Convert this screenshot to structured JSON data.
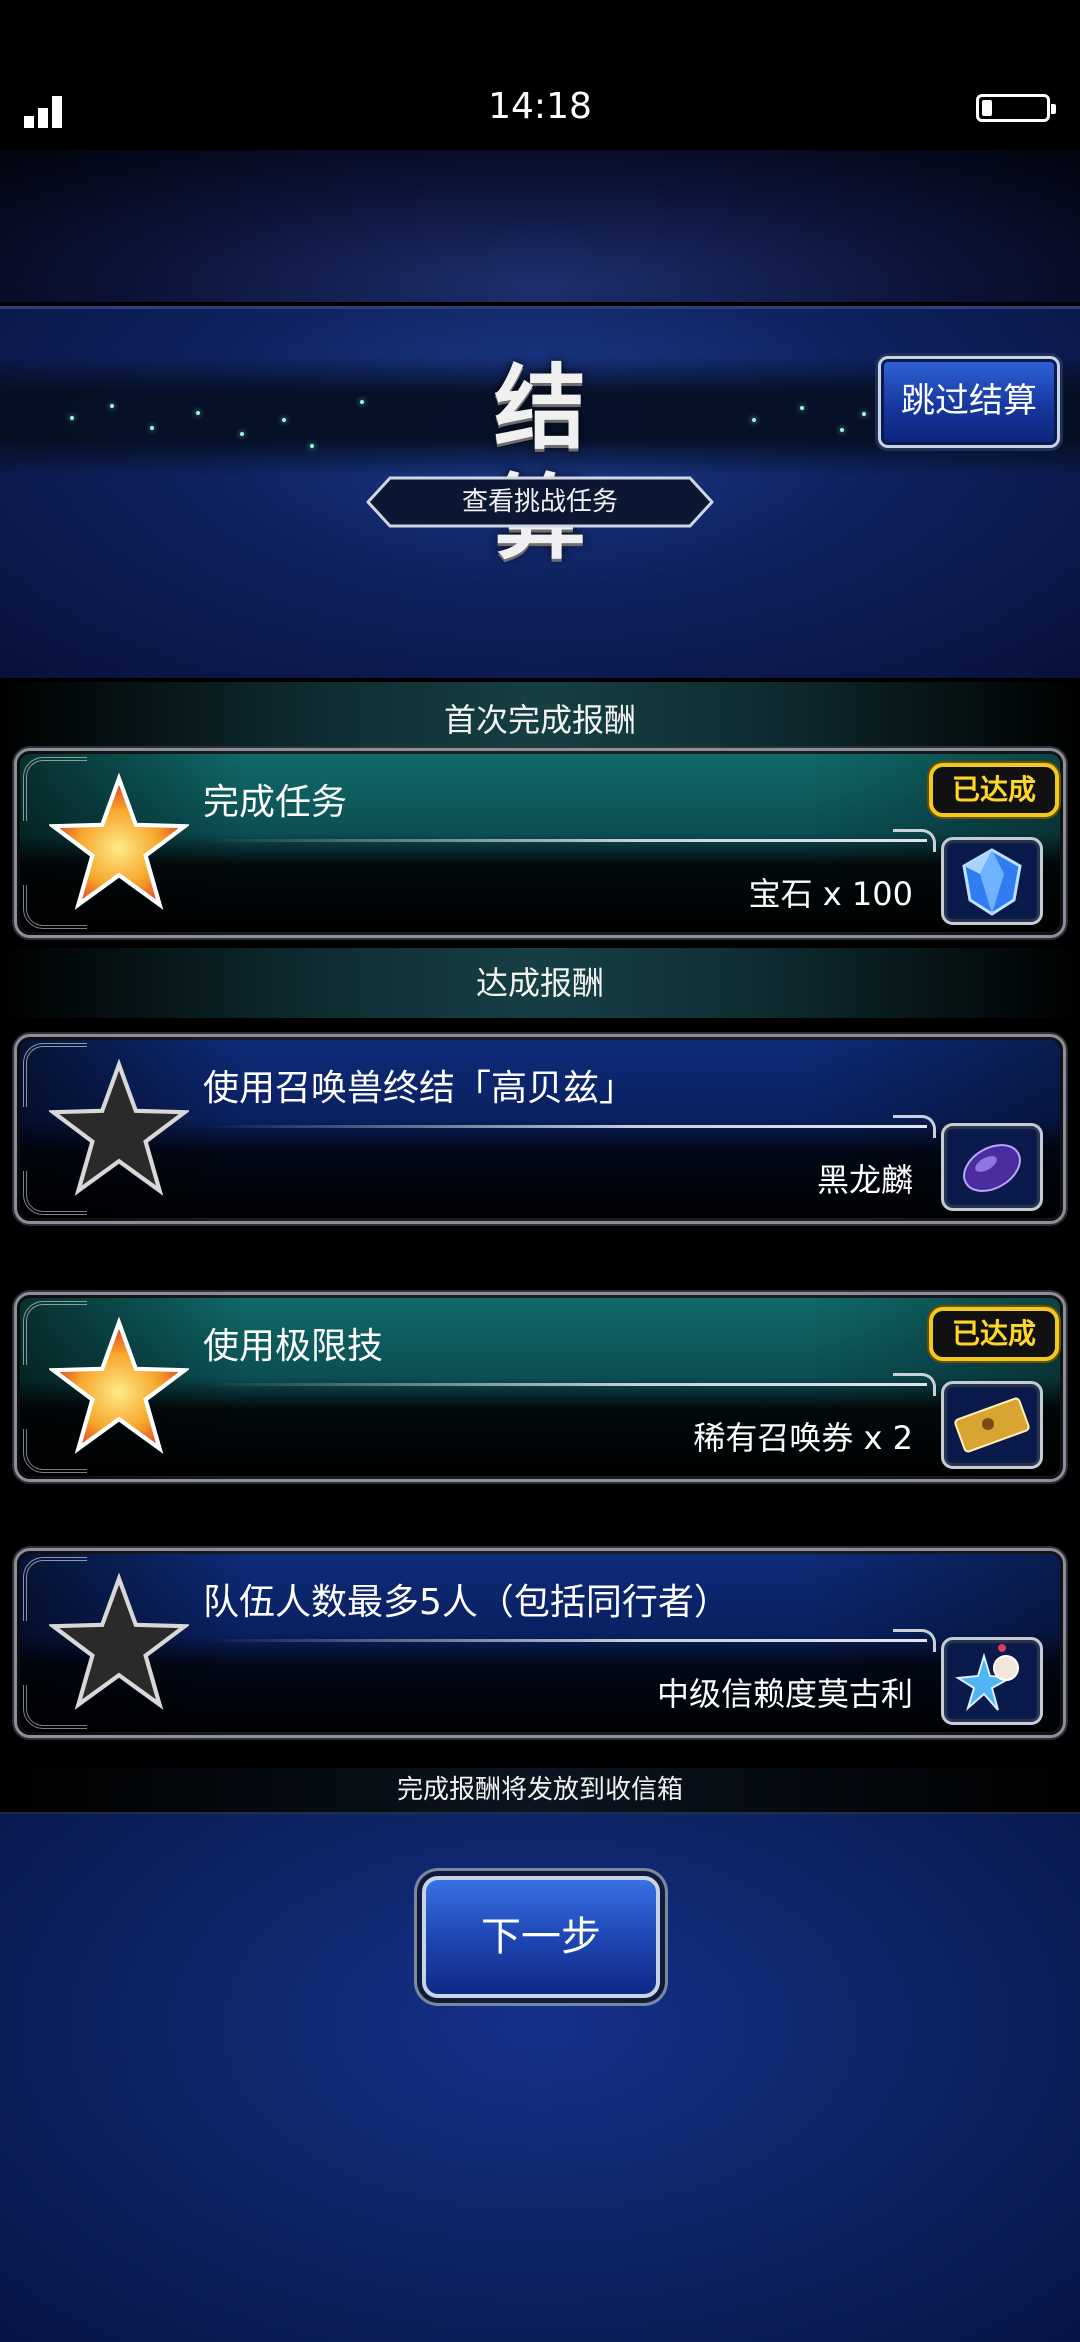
{
  "status_bar": {
    "time": "14:18"
  },
  "header": {
    "title": "结 算",
    "skip_button": "跳过结算",
    "view_missions_button": "查看挑战任务"
  },
  "sections": {
    "first_clear": "首次完成报酬",
    "achievement": "达成报酬"
  },
  "missions": [
    {
      "title": "完成任务",
      "reward": "宝石 x 100",
      "badge": "已达成",
      "achieved": true,
      "reward_icon": "gem-icon"
    },
    {
      "title": "使用召唤兽终结「高贝兹」",
      "reward": "黑龙麟",
      "badge": "",
      "achieved": false,
      "reward_icon": "dark-scale-icon"
    },
    {
      "title": "使用极限技",
      "reward": "稀有召唤券 x 2",
      "badge": "已达成",
      "achieved": true,
      "reward_icon": "ticket-icon"
    },
    {
      "title": "队伍人数最多5人（包括同行者）",
      "reward": "中级信赖度莫古利",
      "badge": "",
      "achieved": false,
      "reward_icon": "moogle-icon"
    }
  ],
  "footer_note": "完成报酬将发放到收信箱",
  "next_button": "下一步",
  "colors": {
    "achieved_badge": "#ffd52a",
    "done_panel": "#0f6c6a",
    "pending_panel": "#0e2c7a",
    "button_blue": "#1e47b4"
  }
}
